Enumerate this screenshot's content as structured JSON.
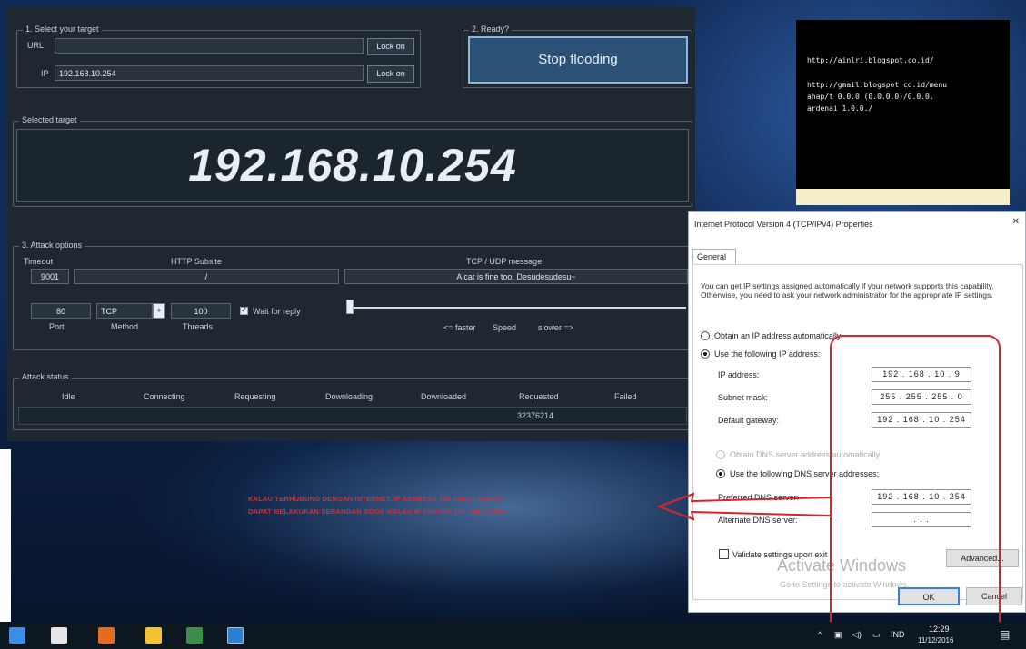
{
  "loic": {
    "select_target_legend": "1. Select your target",
    "url_label": "URL",
    "ip_label": "IP",
    "url_value": "",
    "ip_value": "192.168.10.254",
    "lock_on_label": "Lock on",
    "ready_legend": "2. Ready?",
    "stop_flooding_label": "Stop flooding",
    "selected_target_legend": "Selected target",
    "selected_target_value": "192.168.10.254",
    "attack_options_legend": "3. Attack options",
    "timeout_label": "Timeout",
    "http_subsite_label": "HTTP Subsite",
    "tcp_udp_message_label": "TCP / UDP message",
    "timeout_value": "9001",
    "http_subsite_value": "/",
    "tcp_udp_message_value": "A cat is fine too. Desudesudesu~",
    "port_value": "80",
    "method_value": "TCP",
    "threads_value": "100",
    "wait_reply_label": "Wait for reply",
    "port_label": "Port",
    "method_label": "Method",
    "threads_label": "Threads",
    "faster_label": "<= faster",
    "speed_label": "Speed",
    "slower_label": "slower =>",
    "attack_status_legend": "Attack status",
    "status_columns": [
      "Idle",
      "Connecting",
      "Requesting",
      "Downloading",
      "Downloaded",
      "Requested",
      "Failed"
    ],
    "status_values": [
      "",
      "",
      "",
      "",
      "",
      "32376214",
      ""
    ]
  },
  "cmd": {
    "line1": "http://ainlri.blogspot.co.id/",
    "line2": "http://gmail.blogspot.co.id/menu",
    "line3": "ahap/t 0.0.0 (0.0.0.0)/0.0.0.",
    "line4": "ardenai 1.0.0./"
  },
  "ipv4": {
    "title": "Internet Protocol Version 4 (TCP/IPv4) Properties",
    "close": "✕",
    "tab_general": "General",
    "description": "You can get IP settings assigned automatically if your network supports this capability. Otherwise, you need to ask your network administrator for the appropriate IP settings.",
    "obtain_ip_auto": "Obtain an IP address automatically",
    "use_following_ip": "Use the following IP address:",
    "ip_address_label": "IP address:",
    "subnet_mask_label": "Subnet mask:",
    "default_gateway_label": "Default gateway:",
    "ip_address_value": "192 . 168 . 10 . 9",
    "subnet_mask_value": "255 . 255 . 255 . 0",
    "default_gateway_value": "192 . 168 . 10 . 254",
    "obtain_dns_auto": "Obtain DNS server address automatically",
    "use_following_dns": "Use the following DNS server addresses:",
    "preferred_dns_label": "Preferred DNS server:",
    "alternate_dns_label": "Alternate DNS server:",
    "preferred_dns_value": "192 . 168 . 10 . 254",
    "alternate_dns_value": " .   .   . ",
    "validate_label": "Validate settings upon exit",
    "advanced_label": "Advanced...",
    "ok_label": "OK",
    "cancel_label": "Cancel"
  },
  "annotation": {
    "line1": "KALAU TERHUBUNG DENGAN INTERNET, IP ADDRESS 192.168.10.9 ANDA",
    "line2": "DAPAT MELAKUKAN SERANGAN DDOS WALAU IP SERVER 192.168.10.254"
  },
  "watermark": {
    "title": "Activate Windows",
    "subtitle": "Go to Settings to activate Windows."
  },
  "taskbar": {
    "lang": "IND",
    "time": "12:29",
    "date": "11/12/2016"
  }
}
